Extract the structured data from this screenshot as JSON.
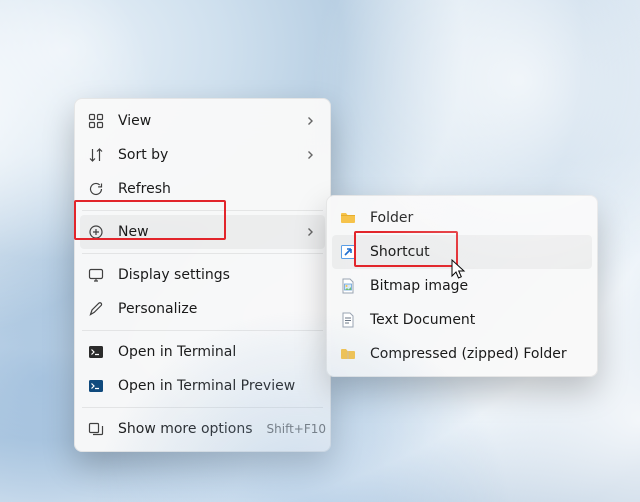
{
  "context_menu": {
    "view": {
      "label": "View",
      "submenu": true
    },
    "sort_by": {
      "label": "Sort by",
      "submenu": true
    },
    "refresh": {
      "label": "Refresh"
    },
    "new": {
      "label": "New",
      "submenu": true,
      "highlighted": true
    },
    "display": {
      "label": "Display settings"
    },
    "personalize": {
      "label": "Personalize"
    },
    "terminal": {
      "label": "Open in Terminal"
    },
    "terminal_pv": {
      "label": "Open in Terminal Preview"
    },
    "more": {
      "label": "Show more options",
      "accelerator": "Shift+F10"
    }
  },
  "new_submenu": {
    "folder": {
      "label": "Folder"
    },
    "shortcut": {
      "label": "Shortcut",
      "highlighted": true
    },
    "bitmap": {
      "label": "Bitmap image"
    },
    "text": {
      "label": "Text Document"
    },
    "zip": {
      "label": "Compressed (zipped) Folder"
    }
  }
}
